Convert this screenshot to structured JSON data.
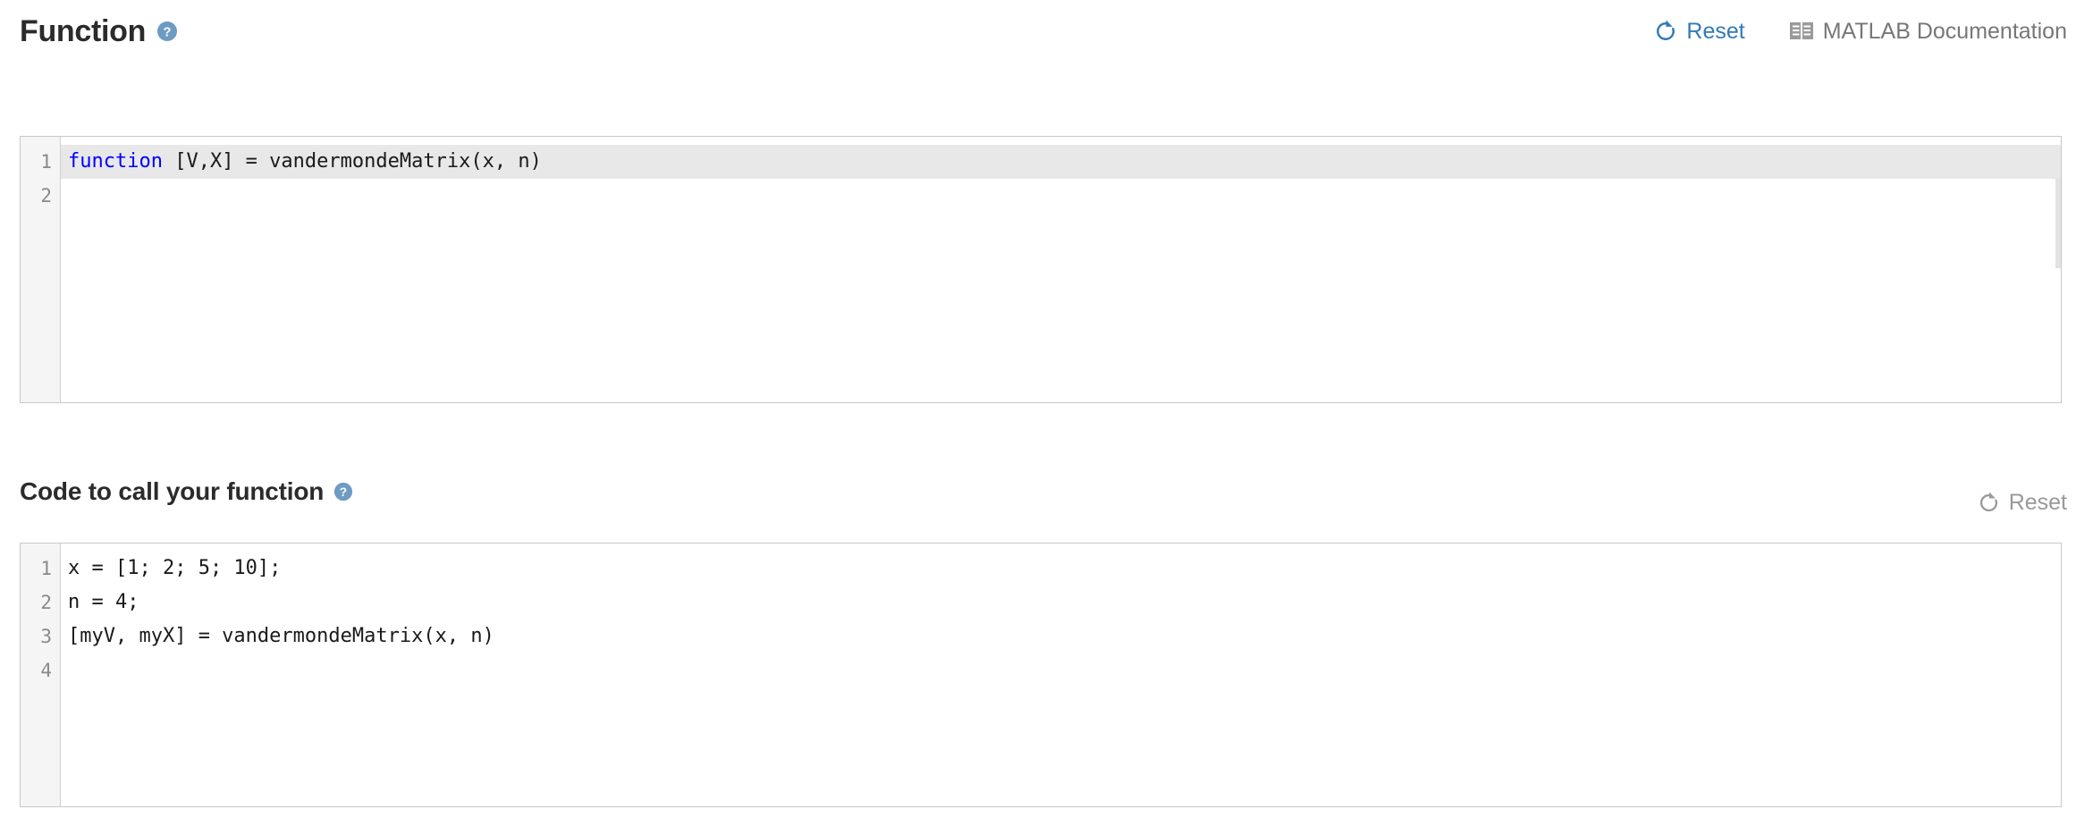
{
  "sections": [
    {
      "id": "function",
      "title": "Function",
      "help_icon": "help-circle-icon",
      "actions": [
        {
          "id": "reset",
          "label": "Reset",
          "icon": "refresh-icon",
          "style": "blue"
        },
        {
          "id": "matlab-docs",
          "label": "MATLAB Documentation",
          "icon": "book-icon",
          "style": "gray"
        }
      ],
      "editor": {
        "line_numbers": [
          "1",
          "2"
        ],
        "lines": [
          {
            "active": true,
            "tokens": [
              {
                "text": "function",
                "type": "keyword"
              },
              {
                "text": " [V,X] = vandermondeMatrix(x, n)",
                "type": "plain"
              }
            ]
          },
          {
            "active": false,
            "tokens": [
              {
                "text": "",
                "type": "plain"
              }
            ]
          }
        ]
      }
    },
    {
      "id": "call-code",
      "title": "Code to call your function",
      "help_icon": "help-circle-icon",
      "actions": [
        {
          "id": "reset",
          "label": "Reset",
          "icon": "refresh-icon",
          "style": "muted"
        }
      ],
      "editor": {
        "line_numbers": [
          "1",
          "2",
          "3",
          "4"
        ],
        "lines": [
          {
            "active": false,
            "tokens": [
              {
                "text": "x = [1; 2; 5; 10];",
                "type": "plain"
              }
            ]
          },
          {
            "active": false,
            "tokens": [
              {
                "text": "n = 4;",
                "type": "plain"
              }
            ]
          },
          {
            "active": false,
            "tokens": [
              {
                "text": "[myV, myX] = vandermondeMatrix(x, n)",
                "type": "plain"
              }
            ]
          },
          {
            "active": false,
            "tokens": [
              {
                "text": "",
                "type": "plain"
              }
            ]
          }
        ]
      }
    }
  ],
  "colors": {
    "accent_blue": "#337ab7",
    "help_icon_blue": "#6d9bc3",
    "keyword_blue": "#0000ff",
    "gutter_bg": "#f5f5f5",
    "active_line_bg": "#e8e8e8",
    "border": "#c8c8c8",
    "heading_text": "#2b2b2b",
    "muted_text": "#999999",
    "gray_text": "#777777"
  }
}
